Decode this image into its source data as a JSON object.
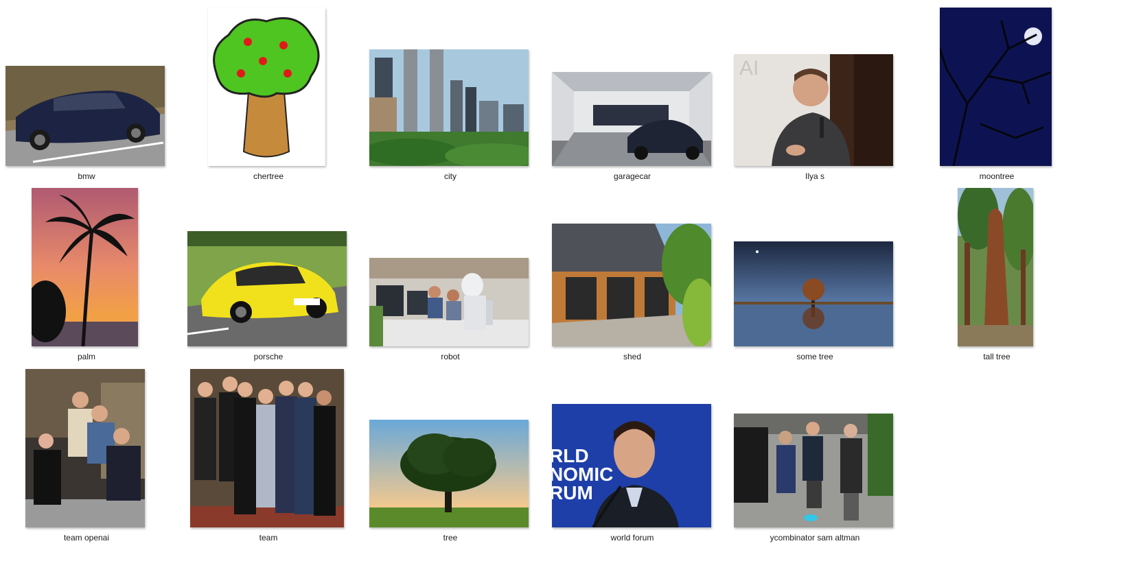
{
  "window": {
    "title": ""
  },
  "items": [
    {
      "name": "bmw",
      "icon": "car-photo"
    },
    {
      "name": "chertree",
      "icon": "cartoon-tree-image"
    },
    {
      "name": "city",
      "icon": "city-skyline-photo"
    },
    {
      "name": "garagecar",
      "icon": "garage-car-photo"
    },
    {
      "name": "Ilya s",
      "icon": "person-speaking-photo"
    },
    {
      "name": "moontree",
      "icon": "moon-tree-photo"
    },
    {
      "name": "palm",
      "icon": "palm-sunset-photo"
    },
    {
      "name": "porsche",
      "icon": "yellow-car-photo"
    },
    {
      "name": "robot",
      "icon": "robot-office-photo"
    },
    {
      "name": "shed",
      "icon": "garage-shed-photo"
    },
    {
      "name": "some tree",
      "icon": "tree-reflection-photo"
    },
    {
      "name": "tall tree",
      "icon": "tall-tree-photo"
    },
    {
      "name": "team openai",
      "icon": "team-photo"
    },
    {
      "name": "team",
      "icon": "group-photo"
    },
    {
      "name": "tree",
      "icon": "lone-tree-photo"
    },
    {
      "name": "world forum",
      "icon": "forum-speaker-photo"
    },
    {
      "name": "ycombinator sam altman",
      "icon": "street-people-photo"
    }
  ]
}
